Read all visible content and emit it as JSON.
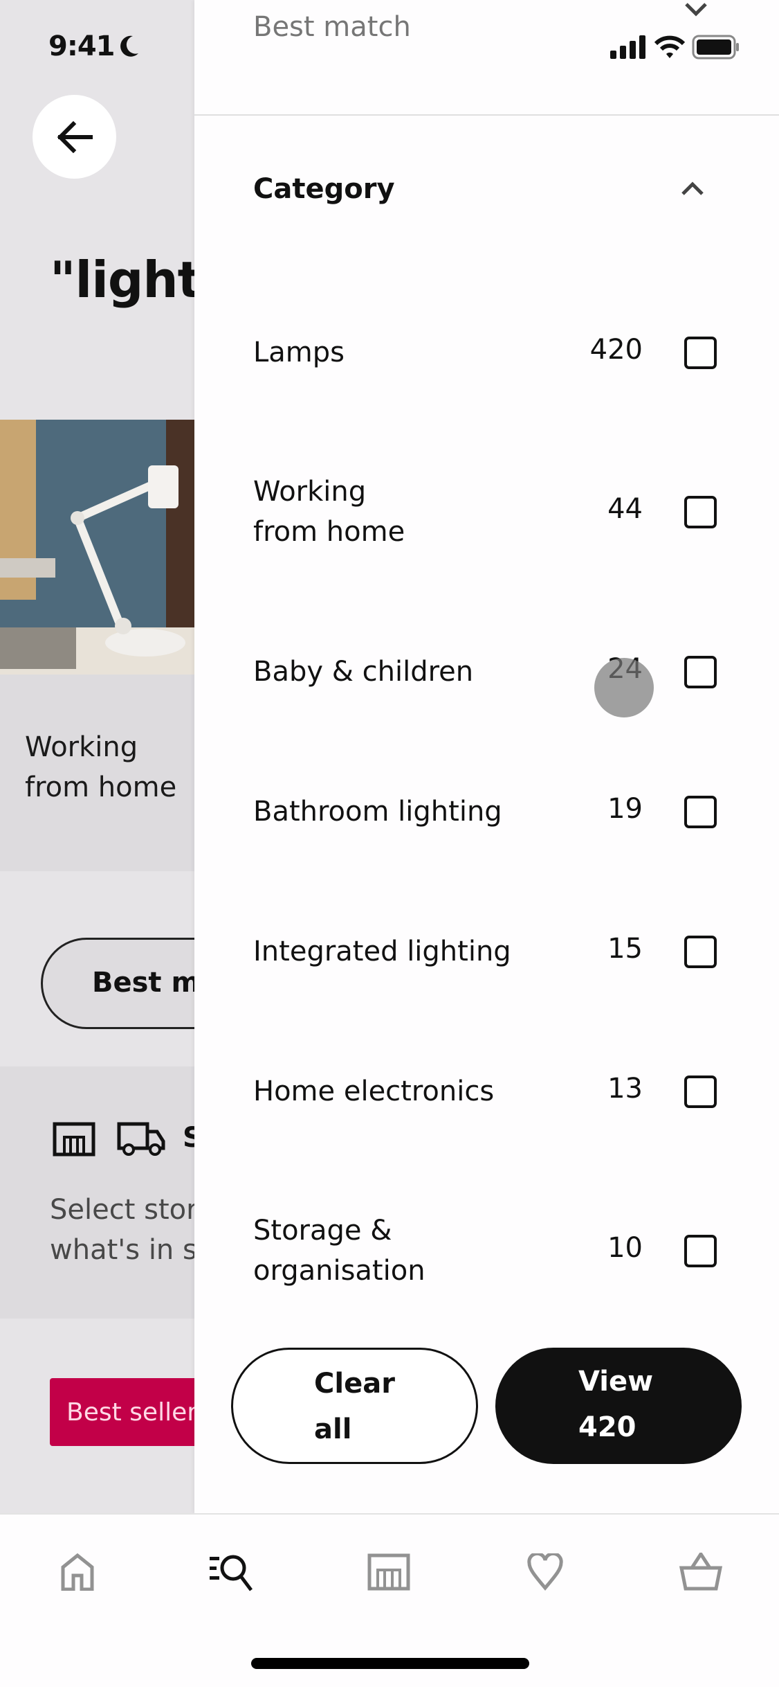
{
  "status_bar": {
    "time": "9:41",
    "icons": [
      "moon-icon",
      "signal-icon",
      "wifi-icon",
      "battery-icon"
    ]
  },
  "background_page": {
    "back_label": "Back",
    "search_title": "\"lighting\"",
    "hero_card_label": "Working\nfrom home",
    "sort_pill_label": "Best match",
    "store_card": {
      "heading": "Store and delivery",
      "text_line1": "Select store to see",
      "text_line2": "what's in stock"
    },
    "badge_label": "Best seller"
  },
  "filter_panel": {
    "sort_value": "Best match",
    "category": {
      "title": "Category",
      "expanded": true,
      "items": [
        {
          "label": "Lamps",
          "count": "420",
          "checked": false
        },
        {
          "label": "Working\nfrom home",
          "count": "44",
          "checked": false
        },
        {
          "label": "Baby & children",
          "count": "24",
          "checked": false
        },
        {
          "label": "Bathroom lighting",
          "count": "19",
          "checked": false
        },
        {
          "label": "Integrated lighting",
          "count": "15",
          "checked": false
        },
        {
          "label": "Home electronics",
          "count": "13",
          "checked": false
        },
        {
          "label": "Storage &\norganisation",
          "count": "10",
          "checked": false
        }
      ]
    },
    "clear_button": {
      "line1": "Clear",
      "line2": "all"
    },
    "view_button": {
      "line1": "View",
      "line2": "420"
    }
  },
  "tab_bar": {
    "tabs": [
      {
        "name": "home",
        "icon": "home-icon",
        "active": false
      },
      {
        "name": "search",
        "icon": "search-icon",
        "active": true
      },
      {
        "name": "store",
        "icon": "store-icon",
        "active": false
      },
      {
        "name": "favourites",
        "icon": "heart-icon",
        "active": false
      },
      {
        "name": "basket",
        "icon": "basket-icon",
        "active": false
      }
    ]
  },
  "colors": {
    "accent_badge": "#c20048",
    "primary_button": "#111111",
    "inactive_icon": "#929292",
    "dim_background": "#e6e4e7"
  }
}
